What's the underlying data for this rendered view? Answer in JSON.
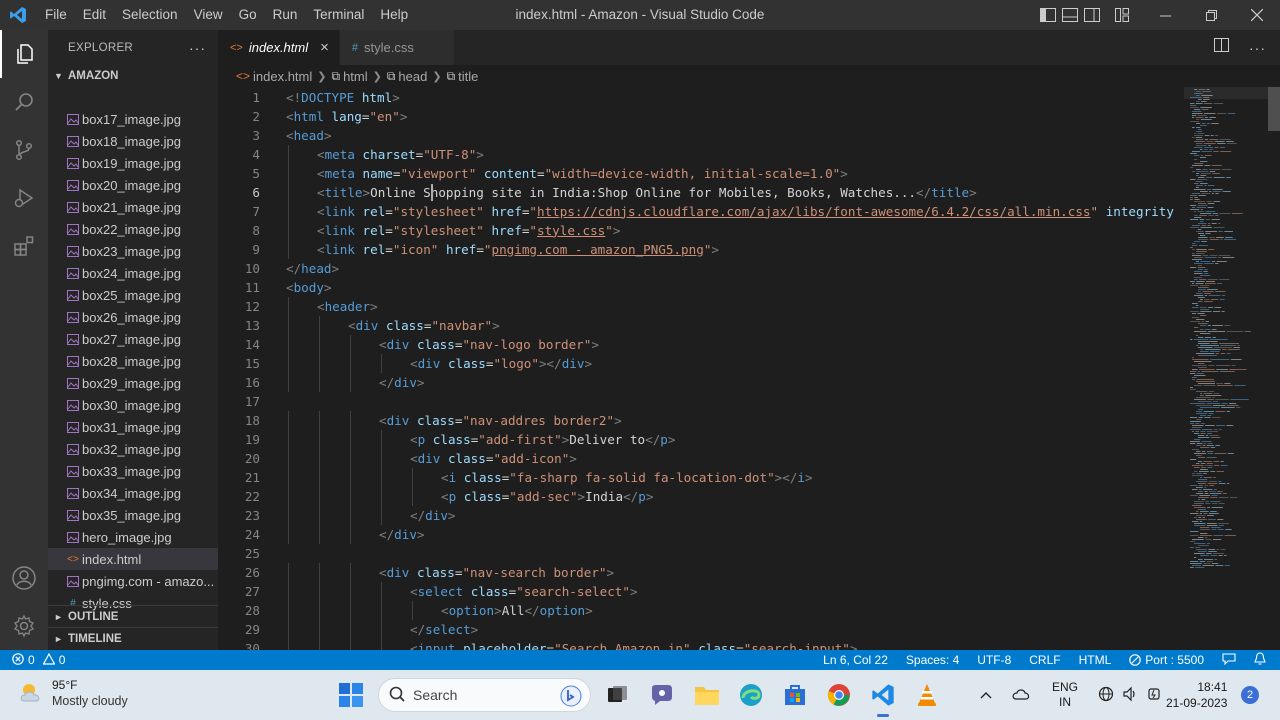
{
  "window": {
    "title": "index.html - Amazon - Visual Studio Code",
    "menus": [
      "File",
      "Edit",
      "Selection",
      "View",
      "Go",
      "Run",
      "Terminal",
      "Help"
    ]
  },
  "sidebar": {
    "explorer_label": "EXPLORER",
    "more": "···",
    "folder": "AMAZON",
    "files": [
      {
        "name": "box17_image.jpg",
        "type": "image"
      },
      {
        "name": "box18_image.jpg",
        "type": "image"
      },
      {
        "name": "box19_image.jpg",
        "type": "image"
      },
      {
        "name": "box20_image.jpg",
        "type": "image"
      },
      {
        "name": "box21_image.jpg",
        "type": "image"
      },
      {
        "name": "box22_image.jpg",
        "type": "image"
      },
      {
        "name": "box23_image.jpg",
        "type": "image"
      },
      {
        "name": "box24_image.jpg",
        "type": "image"
      },
      {
        "name": "box25_image.jpg",
        "type": "image"
      },
      {
        "name": "box26_image.jpg",
        "type": "image"
      },
      {
        "name": "box27_image.jpg",
        "type": "image"
      },
      {
        "name": "box28_image.jpg",
        "type": "image"
      },
      {
        "name": "box29_image.jpg",
        "type": "image"
      },
      {
        "name": "box30_image.jpg",
        "type": "image"
      },
      {
        "name": "box31_image.jpg",
        "type": "image"
      },
      {
        "name": "box32_image.jpg",
        "type": "image"
      },
      {
        "name": "box33_image.jpg",
        "type": "image"
      },
      {
        "name": "box34_image.jpg",
        "type": "image"
      },
      {
        "name": "box35_image.jpg",
        "type": "image"
      },
      {
        "name": "hero_image.jpg",
        "type": "image"
      },
      {
        "name": "index.html",
        "type": "html",
        "active": true
      },
      {
        "name": "pngimg.com - amazo...",
        "type": "image"
      },
      {
        "name": "style.css",
        "type": "css"
      }
    ],
    "outline": "OUTLINE",
    "timeline": "TIMELINE"
  },
  "tabs": [
    {
      "label": "index.html",
      "icon": "<>",
      "active": true,
      "close": "×"
    },
    {
      "label": "style.css",
      "icon": "#",
      "active": false
    }
  ],
  "breadcrumb": [
    "index.html",
    "html",
    "head",
    "title"
  ],
  "editor": {
    "current_line": 6,
    "lines": [
      {
        "n": "1",
        "indent": 0,
        "tokens": [
          [
            "br",
            "<!"
          ],
          [
            "tag",
            "DOCTYPE"
          ],
          [
            "tx",
            " "
          ],
          [
            "at",
            "html"
          ],
          [
            "br",
            ">"
          ]
        ]
      },
      {
        "n": "2",
        "indent": 0,
        "tokens": [
          [
            "br",
            "<"
          ],
          [
            "tag",
            "html"
          ],
          [
            "tx",
            " "
          ],
          [
            "at",
            "lang"
          ],
          [
            "tx",
            "="
          ],
          [
            "st",
            "\"en\""
          ],
          [
            "br",
            ">"
          ]
        ]
      },
      {
        "n": "3",
        "indent": 0,
        "tokens": [
          [
            "br",
            "<"
          ],
          [
            "tag",
            "head"
          ],
          [
            "br",
            ">"
          ]
        ]
      },
      {
        "n": "4",
        "indent": 1,
        "tokens": [
          [
            "br",
            "<"
          ],
          [
            "tag",
            "meta"
          ],
          [
            "tx",
            " "
          ],
          [
            "at",
            "charset"
          ],
          [
            "tx",
            "="
          ],
          [
            "st",
            "\"UTF-8\""
          ],
          [
            "br",
            ">"
          ]
        ]
      },
      {
        "n": "5",
        "indent": 1,
        "tokens": [
          [
            "br",
            "<"
          ],
          [
            "tag",
            "meta"
          ],
          [
            "tx",
            " "
          ],
          [
            "at",
            "name"
          ],
          [
            "tx",
            "="
          ],
          [
            "st",
            "\"viewport\""
          ],
          [
            "tx",
            " "
          ],
          [
            "at",
            "content"
          ],
          [
            "tx",
            "="
          ],
          [
            "st",
            "\"width=device-width, initial-scale=1.0\""
          ],
          [
            "br",
            ">"
          ]
        ]
      },
      {
        "n": "6",
        "indent": 1,
        "tokens": [
          [
            "br",
            "<"
          ],
          [
            "tag",
            "title"
          ],
          [
            "br",
            ">"
          ],
          [
            "tx",
            "Online Shopping site in India:Shop Online for Mobiles, Books, Watches..."
          ],
          [
            "br",
            "</"
          ],
          [
            "tag",
            "title"
          ],
          [
            "br",
            ">"
          ]
        ]
      },
      {
        "n": "7",
        "indent": 1,
        "tokens": [
          [
            "br",
            "<"
          ],
          [
            "tag",
            "link"
          ],
          [
            "tx",
            " "
          ],
          [
            "at",
            "rel"
          ],
          [
            "tx",
            "="
          ],
          [
            "st",
            "\"stylesheet\""
          ],
          [
            "tx",
            " "
          ],
          [
            "at",
            "href"
          ],
          [
            "tx",
            "="
          ],
          [
            "st",
            "\""
          ],
          [
            "stu",
            "https://cdnjs.cloudflare.com/ajax/libs/font-awesome/6.4.2/css/all.min.css"
          ],
          [
            "st",
            "\""
          ],
          [
            "tx",
            " "
          ],
          [
            "at",
            "integrity"
          ]
        ]
      },
      {
        "n": "8",
        "indent": 1,
        "tokens": [
          [
            "br",
            "<"
          ],
          [
            "tag",
            "link"
          ],
          [
            "tx",
            " "
          ],
          [
            "at",
            "rel"
          ],
          [
            "tx",
            "="
          ],
          [
            "st",
            "\"stylesheet\""
          ],
          [
            "tx",
            " "
          ],
          [
            "at",
            "href"
          ],
          [
            "tx",
            "="
          ],
          [
            "st",
            "\""
          ],
          [
            "stu",
            "style.css"
          ],
          [
            "st",
            "\""
          ],
          [
            "br",
            ">"
          ]
        ]
      },
      {
        "n": "9",
        "indent": 1,
        "tokens": [
          [
            "br",
            "<"
          ],
          [
            "tag",
            "link"
          ],
          [
            "tx",
            " "
          ],
          [
            "at",
            "rel"
          ],
          [
            "tx",
            "="
          ],
          [
            "st",
            "\"icon\""
          ],
          [
            "tx",
            " "
          ],
          [
            "at",
            "href"
          ],
          [
            "tx",
            "="
          ],
          [
            "st",
            "\""
          ],
          [
            "stu",
            "pngimg.com - amazon_PNG5.png"
          ],
          [
            "st",
            "\""
          ],
          [
            "br",
            ">"
          ]
        ]
      },
      {
        "n": "10",
        "indent": 0,
        "tokens": [
          [
            "br",
            "</"
          ],
          [
            "tag",
            "head"
          ],
          [
            "br",
            ">"
          ]
        ]
      },
      {
        "n": "11",
        "indent": 0,
        "tokens": [
          [
            "br",
            "<"
          ],
          [
            "tag",
            "body"
          ],
          [
            "br",
            ">"
          ]
        ]
      },
      {
        "n": "12",
        "indent": 1,
        "tokens": [
          [
            "br",
            "<"
          ],
          [
            "tag",
            "header"
          ],
          [
            "br",
            ">"
          ]
        ]
      },
      {
        "n": "13",
        "indent": 2,
        "tokens": [
          [
            "br",
            "<"
          ],
          [
            "tag",
            "div"
          ],
          [
            "tx",
            " "
          ],
          [
            "at",
            "class"
          ],
          [
            "tx",
            "="
          ],
          [
            "st",
            "\"navbar\""
          ],
          [
            "br",
            ">"
          ]
        ]
      },
      {
        "n": "14",
        "indent": 3,
        "tokens": [
          [
            "br",
            "<"
          ],
          [
            "tag",
            "div"
          ],
          [
            "tx",
            " "
          ],
          [
            "at",
            "class"
          ],
          [
            "tx",
            "="
          ],
          [
            "st",
            "\"nav-logo border\""
          ],
          [
            "br",
            ">"
          ]
        ]
      },
      {
        "n": "15",
        "indent": 4,
        "tokens": [
          [
            "br",
            "<"
          ],
          [
            "tag",
            "div"
          ],
          [
            "tx",
            " "
          ],
          [
            "at",
            "class"
          ],
          [
            "tx",
            "="
          ],
          [
            "st",
            "\"logo\""
          ],
          [
            "br",
            "></"
          ],
          [
            "tag",
            "div"
          ],
          [
            "br",
            ">"
          ]
        ]
      },
      {
        "n": "16",
        "indent": 3,
        "tokens": [
          [
            "br",
            "</"
          ],
          [
            "tag",
            "div"
          ],
          [
            "br",
            ">"
          ]
        ]
      },
      {
        "n": "17",
        "indent": 0,
        "tokens": []
      },
      {
        "n": "18",
        "indent": 3,
        "tokens": [
          [
            "br",
            "<"
          ],
          [
            "tag",
            "div"
          ],
          [
            "tx",
            " "
          ],
          [
            "at",
            "class"
          ],
          [
            "tx",
            "="
          ],
          [
            "st",
            "\"nav-addres border2\""
          ],
          [
            "br",
            ">"
          ]
        ]
      },
      {
        "n": "19",
        "indent": 4,
        "tokens": [
          [
            "br",
            "<"
          ],
          [
            "tag",
            "p"
          ],
          [
            "tx",
            " "
          ],
          [
            "at",
            "class"
          ],
          [
            "tx",
            "="
          ],
          [
            "st",
            "\"add-first\""
          ],
          [
            "br",
            ">"
          ],
          [
            "tx",
            "Deliver to"
          ],
          [
            "br",
            "</"
          ],
          [
            "tag",
            "p"
          ],
          [
            "br",
            ">"
          ]
        ]
      },
      {
        "n": "20",
        "indent": 4,
        "tokens": [
          [
            "br",
            "<"
          ],
          [
            "tag",
            "div"
          ],
          [
            "tx",
            " "
          ],
          [
            "at",
            "class"
          ],
          [
            "tx",
            "="
          ],
          [
            "st",
            "\"add-icon\""
          ],
          [
            "br",
            ">"
          ]
        ]
      },
      {
        "n": "21",
        "indent": 5,
        "tokens": [
          [
            "br",
            "<"
          ],
          [
            "tag",
            "i"
          ],
          [
            "tx",
            " "
          ],
          [
            "at",
            "class"
          ],
          [
            "tx",
            "="
          ],
          [
            "st",
            "\"fa-sharp fa-solid fa-location-dot\""
          ],
          [
            "br",
            "></"
          ],
          [
            "tag",
            "i"
          ],
          [
            "br",
            ">"
          ]
        ]
      },
      {
        "n": "22",
        "indent": 5,
        "tokens": [
          [
            "br",
            "<"
          ],
          [
            "tag",
            "p"
          ],
          [
            "tx",
            " "
          ],
          [
            "at",
            "class"
          ],
          [
            "tx",
            "="
          ],
          [
            "st",
            "\"add-sec\""
          ],
          [
            "br",
            ">"
          ],
          [
            "tx",
            "India"
          ],
          [
            "br",
            "</"
          ],
          [
            "tag",
            "p"
          ],
          [
            "br",
            ">"
          ]
        ]
      },
      {
        "n": "23",
        "indent": 4,
        "tokens": [
          [
            "br",
            "</"
          ],
          [
            "tag",
            "div"
          ],
          [
            "br",
            ">"
          ]
        ]
      },
      {
        "n": "24",
        "indent": 3,
        "tokens": [
          [
            "br",
            "</"
          ],
          [
            "tag",
            "div"
          ],
          [
            "br",
            ">"
          ]
        ]
      },
      {
        "n": "25",
        "indent": 0,
        "tokens": []
      },
      {
        "n": "26",
        "indent": 3,
        "tokens": [
          [
            "br",
            "<"
          ],
          [
            "tag",
            "div"
          ],
          [
            "tx",
            " "
          ],
          [
            "at",
            "class"
          ],
          [
            "tx",
            "="
          ],
          [
            "st",
            "\"nav-search border\""
          ],
          [
            "br",
            ">"
          ]
        ]
      },
      {
        "n": "27",
        "indent": 4,
        "tokens": [
          [
            "br",
            "<"
          ],
          [
            "tag",
            "select"
          ],
          [
            "tx",
            " "
          ],
          [
            "at",
            "class"
          ],
          [
            "tx",
            "="
          ],
          [
            "st",
            "\"search-select\""
          ],
          [
            "br",
            ">"
          ]
        ]
      },
      {
        "n": "28",
        "indent": 5,
        "tokens": [
          [
            "br",
            "<"
          ],
          [
            "tag",
            "option"
          ],
          [
            "br",
            ">"
          ],
          [
            "tx",
            "All"
          ],
          [
            "br",
            "</"
          ],
          [
            "tag",
            "option"
          ],
          [
            "br",
            ">"
          ]
        ]
      },
      {
        "n": "29",
        "indent": 4,
        "tokens": [
          [
            "br",
            "</"
          ],
          [
            "tag",
            "select"
          ],
          [
            "br",
            ">"
          ]
        ]
      },
      {
        "n": "30",
        "indent": 4,
        "tokens": [
          [
            "br",
            "<"
          ],
          [
            "tag",
            "input"
          ],
          [
            "tx",
            " "
          ],
          [
            "at",
            "placeholder"
          ],
          [
            "tx",
            "="
          ],
          [
            "st",
            "\"Search Amazon.in\""
          ],
          [
            "tx",
            " "
          ],
          [
            "at",
            "class"
          ],
          [
            "tx",
            "="
          ],
          [
            "st",
            "\"search-input\""
          ],
          [
            "br",
            ">"
          ]
        ]
      }
    ]
  },
  "statusbar": {
    "errors": "0",
    "warnings": "0",
    "position": "Ln 6, Col 22",
    "spaces": "Spaces: 4",
    "encoding": "UTF-8",
    "eol": "CRLF",
    "language": "HTML",
    "port": "Port : 5500"
  },
  "taskbar": {
    "weather_temp": "95°F",
    "weather_desc": "Mostly cloudy",
    "search_label": "Search",
    "lang_top": "ENG",
    "lang_bottom": "IN",
    "time": "18:41",
    "date": "21-09-2023",
    "notifications": "2"
  },
  "colors": {
    "accent": "#007acc",
    "tag": "#569cd6",
    "attribute": "#9cdcfe",
    "string": "#ce9178",
    "text": "#d4d4d4",
    "bracket": "#808080"
  }
}
